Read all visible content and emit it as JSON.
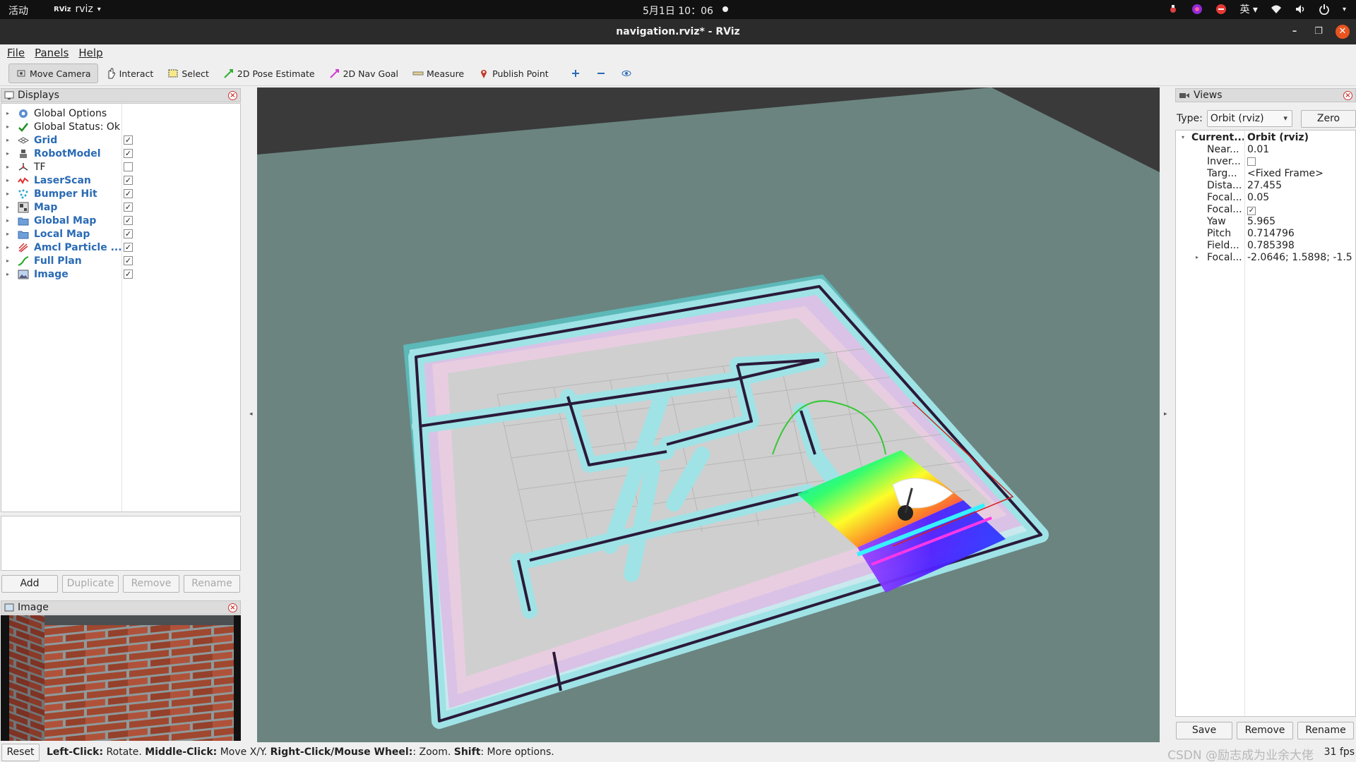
{
  "topbar": {
    "activities": "活动",
    "app_name": "rviz",
    "app_logo": "RViz",
    "clock": "5月1日  10：06",
    "input_method": "英"
  },
  "window": {
    "title": "navigation.rviz* - RViz"
  },
  "menu": [
    "File",
    "Panels",
    "Help"
  ],
  "toolbar": {
    "tools": [
      {
        "label": "Move Camera",
        "icon": "move-camera-icon",
        "active": true
      },
      {
        "label": "Interact",
        "icon": "hand-icon",
        "active": false
      },
      {
        "label": "Select",
        "icon": "select-box-icon",
        "active": false
      },
      {
        "label": "2D Pose Estimate",
        "icon": "pose-arrow-icon",
        "color": "#2fae2f",
        "active": false
      },
      {
        "label": "2D Nav Goal",
        "icon": "goal-arrow-icon",
        "color": "#d13ad1",
        "active": false
      },
      {
        "label": "Measure",
        "icon": "ruler-icon",
        "active": false
      },
      {
        "label": "Publish Point",
        "icon": "map-pin-icon",
        "color": "#c0392b",
        "active": false
      }
    ]
  },
  "displays": {
    "header": "Displays",
    "items": [
      {
        "label": "Global Options",
        "icon": "gear-icon",
        "plugin": false,
        "checked": null
      },
      {
        "label": "Global Status: Ok",
        "icon": "check-icon",
        "plugin": false,
        "checked": null
      },
      {
        "label": "Grid",
        "icon": "grid-icon",
        "plugin": true,
        "checked": true
      },
      {
        "label": "RobotModel",
        "icon": "robot-icon",
        "plugin": true,
        "checked": true
      },
      {
        "label": "TF",
        "icon": "axes-icon",
        "plugin": false,
        "checked": false
      },
      {
        "label": "LaserScan",
        "icon": "laser-icon",
        "plugin": true,
        "checked": true
      },
      {
        "label": "Bumper Hit",
        "icon": "points-icon",
        "plugin": true,
        "checked": true
      },
      {
        "label": "Map",
        "icon": "map-icon",
        "plugin": true,
        "checked": true
      },
      {
        "label": "Global Map",
        "icon": "folder-icon",
        "plugin": true,
        "checked": true
      },
      {
        "label": "Local Map",
        "icon": "folder-icon",
        "plugin": true,
        "checked": true
      },
      {
        "label": "Amcl Particle ...",
        "icon": "particle-icon",
        "plugin": true,
        "checked": true
      },
      {
        "label": "Full Plan",
        "icon": "path-icon",
        "plugin": true,
        "checked": true
      },
      {
        "label": "Image",
        "icon": "image-icon",
        "plugin": true,
        "checked": true
      }
    ],
    "buttons": [
      {
        "label": "Add",
        "enabled": true
      },
      {
        "label": "Duplicate",
        "enabled": false
      },
      {
        "label": "Remove",
        "enabled": false
      },
      {
        "label": "Rename",
        "enabled": false
      }
    ]
  },
  "image_panel": {
    "header": "Image"
  },
  "views": {
    "header": "Views",
    "type_label": "Type:",
    "type_value": "Orbit (rviz)",
    "zero_button": "Zero",
    "rows": [
      {
        "name": "Current...",
        "value": "Orbit (rviz)",
        "bold": true,
        "expanded": true
      },
      {
        "name": "Near...",
        "value": "0.01"
      },
      {
        "name": "Inver...",
        "checkbox": false
      },
      {
        "name": "Targ...",
        "value": "<Fixed Frame>"
      },
      {
        "name": "Dista...",
        "value": "27.455"
      },
      {
        "name": "Focal...",
        "value": "0.05"
      },
      {
        "name": "Focal...",
        "checkbox": true
      },
      {
        "name": "Yaw",
        "value": "5.965"
      },
      {
        "name": "Pitch",
        "value": "0.714796"
      },
      {
        "name": "Field...",
        "value": "0.785398"
      },
      {
        "name": "Focal...",
        "value": "-2.0646; 1.5898; -1.5...",
        "collapsed": true
      }
    ],
    "buttons": [
      "Save",
      "Remove",
      "Rename"
    ]
  },
  "statusbar": {
    "reset": "Reset",
    "help_parts": [
      {
        "text": "Left-Click:",
        "bold": true
      },
      {
        "text": " Rotate. ",
        "bold": false
      },
      {
        "text": "Middle-Click:",
        "bold": true
      },
      {
        "text": " Move X/Y. ",
        "bold": false
      },
      {
        "text": "Right-Click/Mouse Wheel:",
        "bold": true
      },
      {
        "text": ": Zoom. ",
        "bold": false
      },
      {
        "text": "Shift",
        "bold": true
      },
      {
        "text": ": More options.",
        "bold": false
      }
    ],
    "fps": "31 fps",
    "watermark": "CSDN @励志成为业余大佬"
  },
  "colors": {
    "viewport_bg": "#6b8480",
    "plugin_text": "#2a6bb5",
    "close_accent": "#e95420"
  }
}
